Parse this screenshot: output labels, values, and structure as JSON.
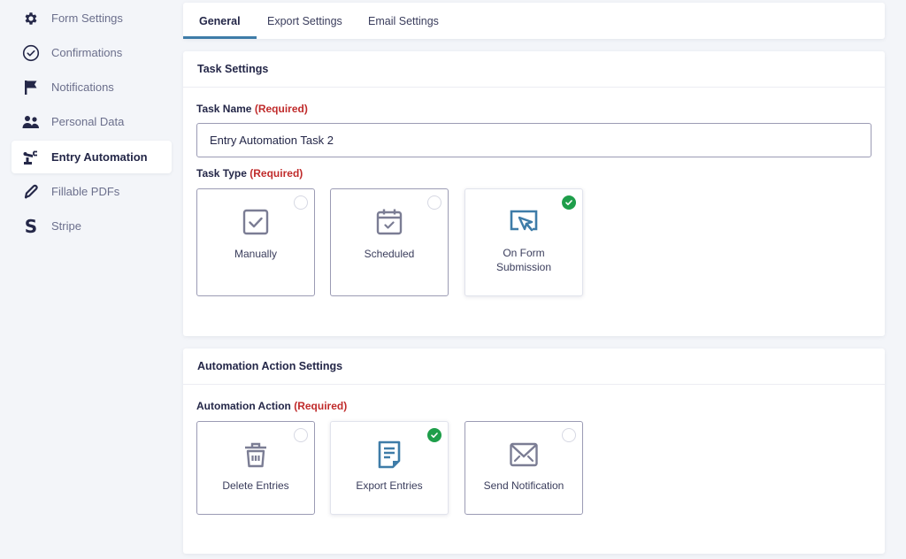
{
  "sidebar": {
    "items": [
      {
        "label": "Form Settings",
        "icon": "gear-icon",
        "active": false
      },
      {
        "label": "Confirmations",
        "icon": "check-circle-icon",
        "active": false
      },
      {
        "label": "Notifications",
        "icon": "flag-icon",
        "active": false
      },
      {
        "label": "Personal Data",
        "icon": "users-icon",
        "active": false
      },
      {
        "label": "Entry Automation",
        "icon": "robot-arm-icon",
        "active": true
      },
      {
        "label": "Fillable PDFs",
        "icon": "pen-icon",
        "active": false
      },
      {
        "label": "Stripe",
        "icon": "stripe-s-icon",
        "active": false
      }
    ]
  },
  "tabs": [
    {
      "label": "General",
      "active": true
    },
    {
      "label": "Export Settings",
      "active": false
    },
    {
      "label": "Email Settings",
      "active": false
    }
  ],
  "task_settings": {
    "title": "Task Settings",
    "task_name": {
      "label": "Task Name",
      "required": "(Required)",
      "value": "Entry Automation Task 2"
    },
    "task_type": {
      "label": "Task Type",
      "required": "(Required)",
      "options": [
        {
          "label": "Manually",
          "icon": "checkbox-icon",
          "selected": false
        },
        {
          "label": "Scheduled",
          "icon": "calendar-icon",
          "selected": false
        },
        {
          "label": "On Form Submission",
          "icon": "cursor-screen-icon",
          "selected": true
        }
      ]
    }
  },
  "action_settings": {
    "title": "Automation Action Settings",
    "automation_action": {
      "label": "Automation Action",
      "required": "(Required)",
      "options": [
        {
          "label": "Delete Entries",
          "icon": "trash-icon",
          "selected": false
        },
        {
          "label": "Export Entries",
          "icon": "document-icon",
          "selected": true
        },
        {
          "label": "Send Notification",
          "icon": "envelope-icon",
          "selected": false
        }
      ]
    }
  },
  "colors": {
    "accent": "#3e7ca8",
    "selected_check": "#1e9e4a",
    "required": "#c02b2b"
  }
}
